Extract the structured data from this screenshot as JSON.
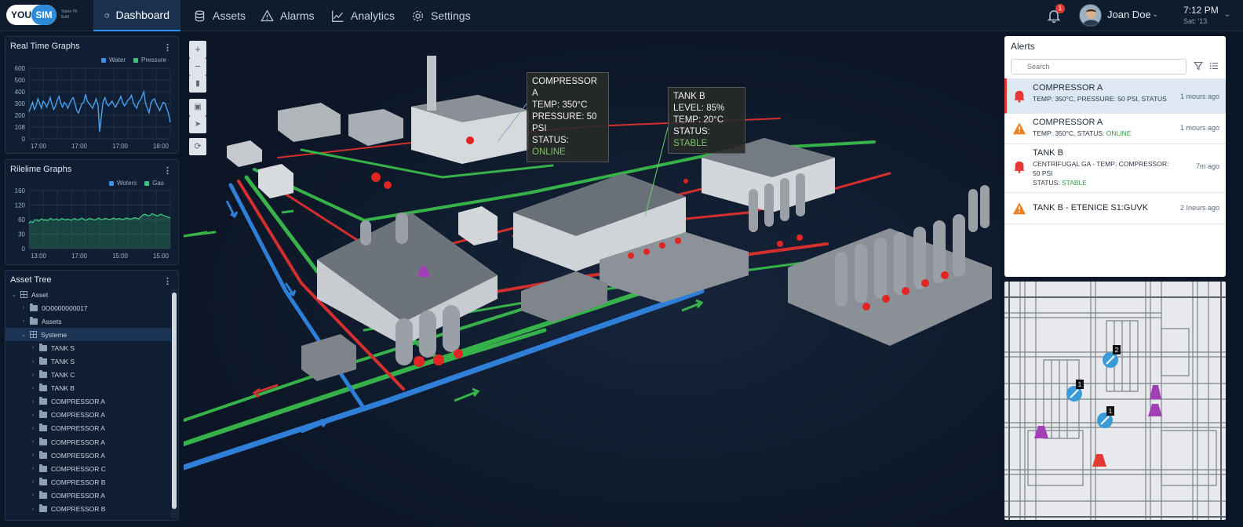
{
  "app": {
    "logo_you": "YOU",
    "logo_sim": "SIM",
    "logo_tagline": "Stairs-Yh Enkf"
  },
  "nav": [
    {
      "label": "Dashboard",
      "icon": "speedometer-icon",
      "active": true
    },
    {
      "label": "Assets",
      "icon": "database-icon",
      "active": false
    },
    {
      "label": "Alarms",
      "icon": "warning-triangle-icon",
      "active": false
    },
    {
      "label": "Analytics",
      "icon": "line-chart-icon",
      "active": false
    },
    {
      "label": "Settings",
      "icon": "gear-icon",
      "active": false
    }
  ],
  "header": {
    "notification_count": "1",
    "user_name": "Joan Doe",
    "time": "7:12 PM",
    "date": "Sat: '13"
  },
  "realtime_panel": {
    "title": "Real Time Graphs",
    "legend": [
      {
        "name": "Water",
        "color": "#3d8ee8"
      },
      {
        "name": "Pressure",
        "color": "#3fbf7f"
      }
    ]
  },
  "pipeline_panel": {
    "title": "Rilelime Graphs",
    "legend": [
      {
        "name": "Woters",
        "color": "#3d8ee8"
      },
      {
        "name": "Gas",
        "color": "#3fbf7f"
      }
    ]
  },
  "chart_data": [
    {
      "type": "line",
      "title": "Real Time Graphs",
      "y_ticks": [
        "600",
        "500",
        "400",
        "300",
        "200",
        "108",
        "0"
      ],
      "x_ticks": [
        "17:00",
        "17:00",
        "17:00",
        "18:00"
      ],
      "series": [
        {
          "name": "Water",
          "values": [
            230,
            270,
            310,
            250,
            280,
            340,
            300,
            260,
            320,
            300,
            270,
            310,
            350,
            290,
            250,
            280,
            330,
            360,
            300,
            270,
            310,
            290,
            260,
            300,
            330,
            350,
            300,
            240,
            220,
            260,
            300,
            310,
            380,
            320,
            300,
            280,
            260,
            300,
            340,
            290,
            60,
            200,
            320,
            350,
            300,
            280,
            300,
            320,
            290,
            270,
            300,
            330,
            360,
            310,
            280,
            300,
            330,
            340,
            370,
            310,
            280,
            260,
            310,
            330,
            360,
            400,
            300,
            260,
            220,
            300,
            330,
            340,
            300,
            270,
            240,
            280,
            310,
            300,
            260,
            210,
            140
          ]
        }
      ]
    },
    {
      "type": "area",
      "title": "Rilelime Graphs",
      "y_ticks": [
        "160",
        "120",
        "60",
        "30",
        "0"
      ],
      "x_ticks": [
        "13:00",
        "17:00",
        "15:00",
        "15:00"
      ],
      "series": [
        {
          "name": "Gas",
          "values": [
            70,
            75,
            72,
            78,
            80,
            76,
            79,
            82,
            78,
            80,
            77,
            81,
            83,
            79,
            80,
            82,
            78,
            80,
            83,
            81,
            79,
            82,
            80,
            78,
            81,
            83,
            80,
            79,
            82,
            84,
            80,
            78,
            81,
            83,
            82,
            80,
            79,
            82,
            84,
            81,
            80,
            82,
            83,
            81,
            80,
            82,
            84,
            82,
            81,
            83,
            82,
            80,
            82,
            84,
            83,
            81,
            82,
            84,
            85,
            83,
            82,
            88,
            92,
            95,
            93,
            90,
            92,
            96,
            94,
            92,
            90,
            93,
            95,
            92,
            90,
            88,
            86,
            84
          ]
        }
      ]
    }
  ],
  "asset_tree": {
    "title": "Asset Tree",
    "rows": [
      {
        "label": "Asset",
        "level": 0,
        "expanded": true,
        "icon": "grid-icon"
      },
      {
        "label": "0O0000000017",
        "level": 1,
        "expanded": false,
        "icon": "folder-icon"
      },
      {
        "label": "Assets",
        "level": 1,
        "expanded": false,
        "icon": "folder-icon"
      },
      {
        "label": "Systeme",
        "level": 1,
        "expanded": true,
        "icon": "grid-icon",
        "selected": true
      },
      {
        "label": "TANK S",
        "level": 2,
        "expanded": false,
        "icon": "folder-icon"
      },
      {
        "label": "TANK S",
        "level": 2,
        "expanded": false,
        "icon": "folder-icon"
      },
      {
        "label": "TANK C",
        "level": 2,
        "expanded": false,
        "icon": "folder-icon"
      },
      {
        "label": "TANK B",
        "level": 2,
        "expanded": false,
        "icon": "folder-icon"
      },
      {
        "label": "COMPRESSOR A",
        "level": 2,
        "expanded": false,
        "icon": "folder-icon"
      },
      {
        "label": "COMPRESSOR A",
        "level": 2,
        "expanded": false,
        "icon": "folder-icon"
      },
      {
        "label": "COMPRESSOR A",
        "level": 2,
        "expanded": false,
        "icon": "folder-icon"
      },
      {
        "label": "COMPRESSOR A",
        "level": 2,
        "expanded": false,
        "icon": "folder-icon"
      },
      {
        "label": "COMPRESSOR A",
        "level": 2,
        "expanded": false,
        "icon": "folder-icon"
      },
      {
        "label": "COMPRESSOR C",
        "level": 2,
        "expanded": false,
        "icon": "folder-icon"
      },
      {
        "label": "COMPRESSOR B",
        "level": 2,
        "expanded": false,
        "icon": "folder-icon"
      },
      {
        "label": "COMPRESSOR A",
        "level": 2,
        "expanded": false,
        "icon": "folder-icon"
      },
      {
        "label": "COMPRESSOR B",
        "level": 2,
        "expanded": false,
        "icon": "folder-icon"
      }
    ]
  },
  "scene": {
    "callouts": [
      {
        "lines": [
          "COMPRESSOR A",
          "TEMP: 350°C",
          "PRESSURE: 50 PSI"
        ],
        "status_label": "STATUS: ",
        "status_value": "ONLINE"
      },
      {
        "lines": [
          "TANK B",
          "LEVEL: 85%",
          "TEMP: 20°C"
        ],
        "status_label": "STATUS: ",
        "status_value": "STABLE"
      }
    ],
    "tools": [
      "zoom-in-icon",
      "zoom-out-icon",
      "ruler-icon",
      "layers-icon",
      "cursor-icon",
      "rotate-icon"
    ]
  },
  "alerts": {
    "title": "Alerts",
    "search_placeholder": "Search",
    "items": [
      {
        "title": "COMPRESSOR A",
        "sub": "TEMP: 350°C, PRESSURE: 50 PSI, STATUS",
        "time": "1 mours ago",
        "severity": "critical",
        "icon": "bell-alert-icon",
        "selected": true
      },
      {
        "title": "COMPRESSOR A",
        "sub_prefix": "TEMP: 350°C, STATUS: ",
        "sub_status": "ONLINE",
        "time": "1 mours ago",
        "severity": "warning",
        "icon": "warning-triangle-icon"
      },
      {
        "title": "TANK B",
        "sub_line1": "CENTRIFUGAL GA - TEMP: COMPRESSOR:",
        "sub_line2": "50 PSI",
        "sub_prefix": "STATUS: ",
        "sub_status": "STABLE",
        "time": "7m ago",
        "severity": "critical",
        "icon": "bell-alert-icon"
      },
      {
        "title": "TANK B - ETENICE S1:GUVK",
        "time": "2 Ineurs ago",
        "severity": "warning",
        "icon": "warning-triangle-icon"
      }
    ]
  },
  "minimap": {
    "markers": [
      "2",
      "1",
      "1"
    ]
  }
}
